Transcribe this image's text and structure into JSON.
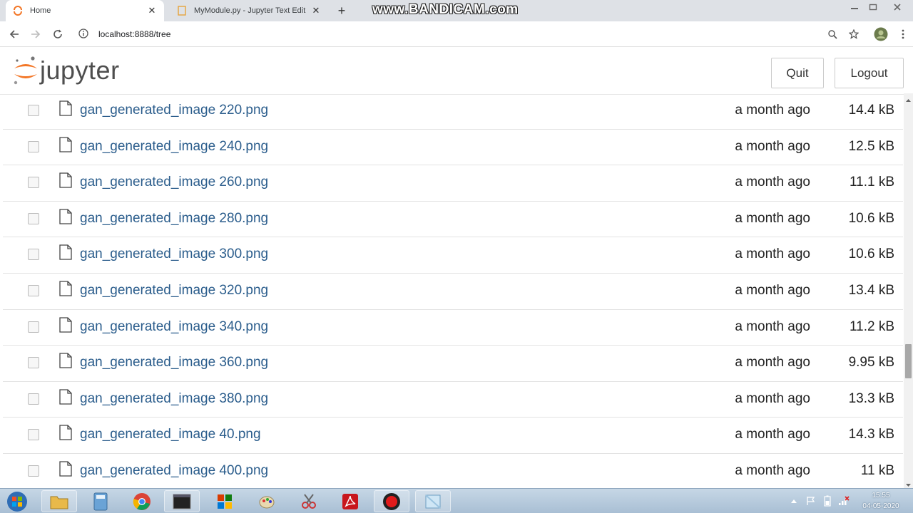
{
  "browser": {
    "tabs": [
      {
        "title": "Home",
        "active": true
      },
      {
        "title": "MyModule.py - Jupyter Text Edit",
        "active": false
      }
    ],
    "watermark": "www.BANDICAM.com",
    "url": "localhost:8888/tree"
  },
  "header": {
    "logo_text": "jupyter",
    "quit_label": "Quit",
    "logout_label": "Logout"
  },
  "files": [
    {
      "name": "gan_generated_image 220.png",
      "modified": "a month ago",
      "size": "14.4 kB"
    },
    {
      "name": "gan_generated_image 240.png",
      "modified": "a month ago",
      "size": "12.5 kB"
    },
    {
      "name": "gan_generated_image 260.png",
      "modified": "a month ago",
      "size": "11.1 kB"
    },
    {
      "name": "gan_generated_image 280.png",
      "modified": "a month ago",
      "size": "10.6 kB"
    },
    {
      "name": "gan_generated_image 300.png",
      "modified": "a month ago",
      "size": "10.6 kB"
    },
    {
      "name": "gan_generated_image 320.png",
      "modified": "a month ago",
      "size": "13.4 kB"
    },
    {
      "name": "gan_generated_image 340.png",
      "modified": "a month ago",
      "size": "11.2 kB"
    },
    {
      "name": "gan_generated_image 360.png",
      "modified": "a month ago",
      "size": "9.95 kB"
    },
    {
      "name": "gan_generated_image 380.png",
      "modified": "a month ago",
      "size": "13.3 kB"
    },
    {
      "name": "gan_generated_image 40.png",
      "modified": "a month ago",
      "size": "14.3 kB"
    },
    {
      "name": "gan_generated_image 400.png",
      "modified": "a month ago",
      "size": "11 kB"
    }
  ],
  "taskbar": {
    "time": "15:55",
    "date": "04-05-2020",
    "items": [
      "windows-start-icon",
      "file-explorer-icon",
      "calculator-icon",
      "chrome-icon",
      "terminal-icon",
      "office-icon",
      "paint-icon",
      "snipping-tool-icon",
      "acrobat-icon",
      "bandicam-record-icon",
      "python-idle-icon"
    ]
  },
  "colors": {
    "link": "#2b5d8c",
    "jupyter_orange": "#f37626",
    "tabstrip": "#dee1e6"
  }
}
